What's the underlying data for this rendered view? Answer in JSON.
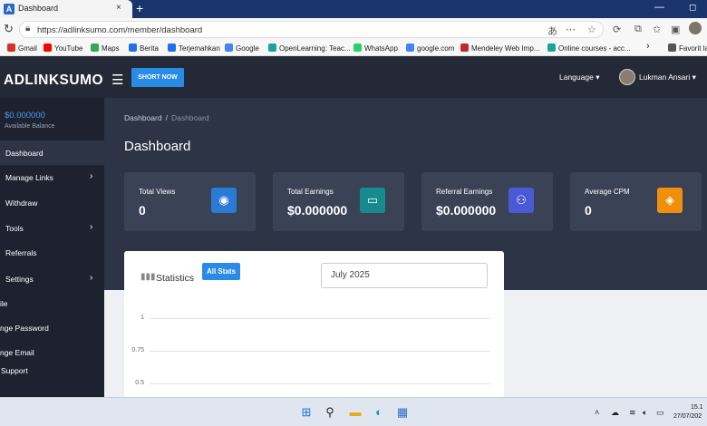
{
  "browser": {
    "tab_title": "Dashboard",
    "tab_icon_letter": "A",
    "tab_close": "×",
    "new_tab": "+",
    "url": "https://adlinksumo.com/member/dashboard",
    "bookmarks": [
      {
        "label": "Gmail",
        "color": "#d93025"
      },
      {
        "label": "YouTube",
        "color": "#ff0000"
      },
      {
        "label": "Maps",
        "color": "#34a853"
      },
      {
        "label": "Berita",
        "color": "#1a73e8"
      },
      {
        "label": "Terjemahkan",
        "color": "#1a73e8"
      },
      {
        "label": "Google",
        "color": "#4285f4"
      },
      {
        "label": "OpenLearning: Teac...",
        "color": "#1aa59b"
      },
      {
        "label": "WhatsApp",
        "color": "#25d366"
      },
      {
        "label": "google.com",
        "color": "#4285f4"
      },
      {
        "label": "Mendeley Web Imp...",
        "color": "#c1272d"
      },
      {
        "label": "Online courses - acc...",
        "color": "#1aa59b"
      },
      {
        "label": "Favorit la",
        "color": "#555555"
      }
    ],
    "bookmark_more": "›"
  },
  "app": {
    "brand": "ADLINKSUMO",
    "short_now": "SHORT NOW",
    "language": "Language",
    "user_name": "Lukman Ansari",
    "dropdown_caret": "▾"
  },
  "sidebar": {
    "balance": "$0.000000",
    "balance_label": "Available Balance",
    "items": [
      {
        "label": "Dashboard",
        "chevron": ""
      },
      {
        "label": "Manage Links",
        "chevron": "›"
      },
      {
        "label": "Withdraw",
        "chevron": ""
      },
      {
        "label": "Tools",
        "chevron": "›"
      },
      {
        "label": "Referrals",
        "chevron": ""
      },
      {
        "label": "Settings",
        "chevron": "›"
      }
    ],
    "subitems": [
      "ile",
      "nge Password",
      "nge Email",
      "Support"
    ]
  },
  "content": {
    "breadcrumb_root": "Dashboard",
    "breadcrumb_sep": "/",
    "breadcrumb_current": "Dashboard",
    "page_title": "Dashboard",
    "cards": [
      {
        "label": "Total Views",
        "value": "0",
        "icon": "views-icon",
        "icon_color": "#2a7bd5"
      },
      {
        "label": "Total Earnings",
        "value": "$0.000000",
        "icon": "wallet-icon",
        "icon_color": "#178a8f"
      },
      {
        "label": "Referral Earnings",
        "value": "$0.000000",
        "icon": "referral-users-icon",
        "icon_color": "#4a59d6"
      },
      {
        "label": "Average CPM",
        "value": "0",
        "icon": "price-tag-icon",
        "icon_color": "#f0900a"
      }
    ]
  },
  "stats": {
    "title": "Statistics",
    "all_stats": "All Stats",
    "month": "July 2025",
    "y_ticks": [
      "1",
      "0.75",
      "0.5"
    ]
  },
  "taskbar": {
    "time": "15.1",
    "date": "27/07/202"
  }
}
